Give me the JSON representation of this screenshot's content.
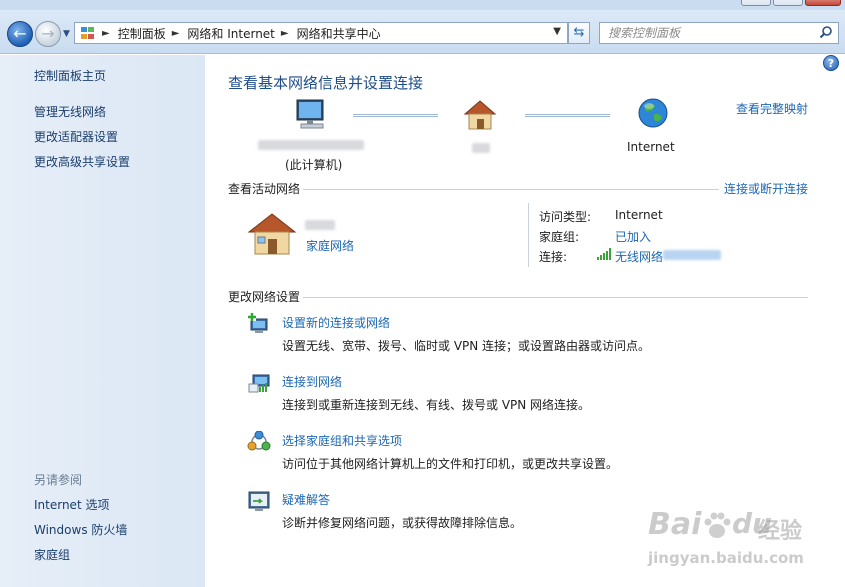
{
  "address": {
    "breadcrumb": [
      "控制面板",
      "网络和 Internet",
      "网络和共享中心"
    ],
    "search_placeholder": "搜索控制面板"
  },
  "sidebar": {
    "items": [
      "控制面板主页",
      "管理无线网络",
      "更改适配器设置",
      "更改高级共享设置"
    ],
    "see_also_title": "另请参阅",
    "see_also": [
      "Internet 选项",
      "Windows 防火墙",
      "家庭组"
    ]
  },
  "main": {
    "title": "查看基本网络信息并设置连接",
    "full_map_link": "查看完整映射",
    "map": {
      "computer_label": "(此计算机)",
      "internet_label": "Internet"
    },
    "active": {
      "title": "查看活动网络",
      "connect_link": "连接或断开连接",
      "network_type": "家庭网络",
      "access_type_label": "访问类型:",
      "access_type_value": "Internet",
      "homegroup_label": "家庭组:",
      "homegroup_value": "已加入",
      "connection_label": "连接:",
      "connection_value": "无线网络"
    },
    "change": {
      "title": "更改网络设置",
      "tasks": [
        {
          "link": "设置新的连接或网络",
          "desc": "设置无线、宽带、拨号、临时或 VPN 连接；或设置路由器或访问点。"
        },
        {
          "link": "连接到网络",
          "desc": "连接到或重新连接到无线、有线、拨号或 VPN 网络连接。"
        },
        {
          "link": "选择家庭组和共享选项",
          "desc": "访问位于其他网络计算机上的文件和打印机，或更改共享设置。"
        },
        {
          "link": "疑难解答",
          "desc": "诊断并修复网络问题，或获得故障排除信息。"
        }
      ]
    }
  },
  "watermark": {
    "brand": "Bai",
    "brand2": "du",
    "brand_cn": "经验",
    "url": "jingyan.baidu.com"
  },
  "colors": {
    "link": "#1c67b4",
    "title": "#1e4d8c",
    "sidebar": "#dfe9f5"
  }
}
